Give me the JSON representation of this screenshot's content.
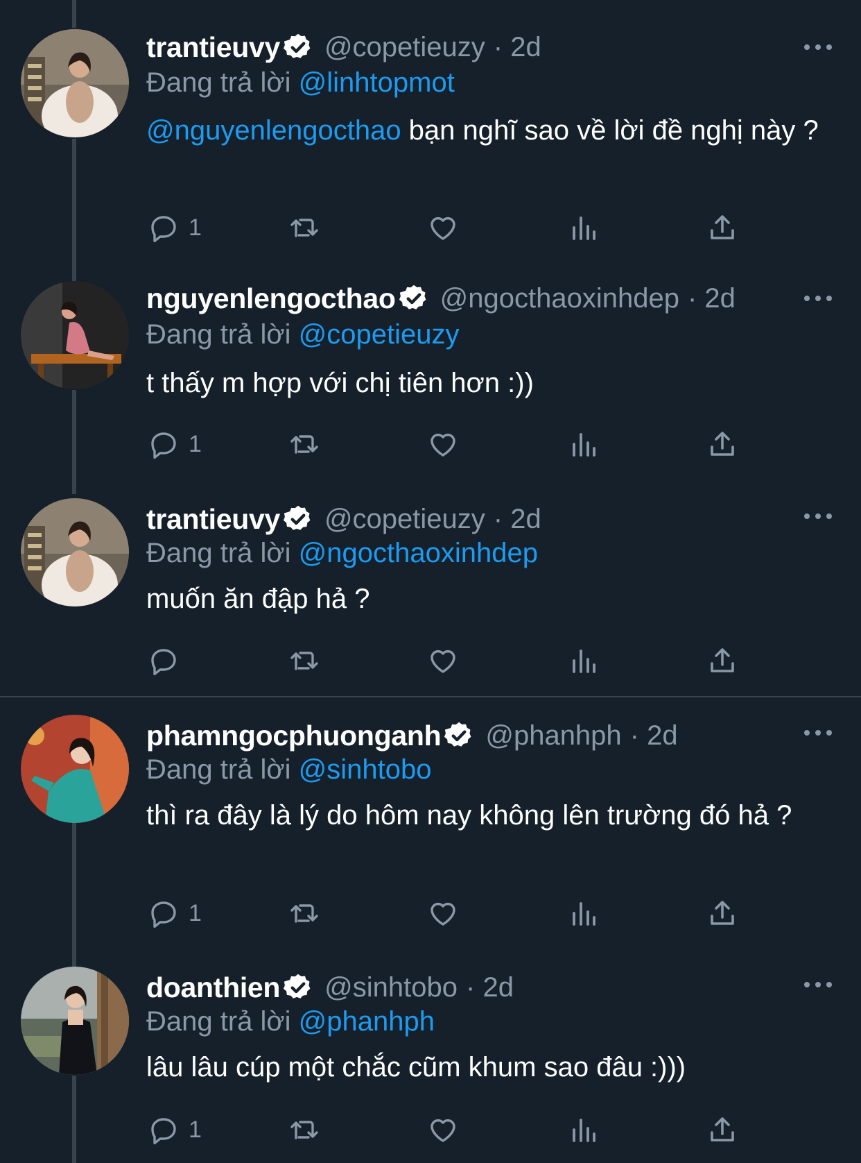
{
  "reply_prefix": "Đang trả lời",
  "colors": {
    "background": "#15202b",
    "text": "#ffffff",
    "muted": "#8b98a5",
    "link": "#1d9bf0",
    "line": "#38444d"
  },
  "tweets": [
    {
      "name": "trantieuvy",
      "handle": "@copetieuzy",
      "time": "· 2d",
      "reply_to": "@linhtopmot",
      "mention": "@nguyenlengocthao",
      "text": " bạn nghĩ sao về lời đề nghị này ?",
      "reply_count": "1",
      "avatar_icon": "woman-white-fur-avatar"
    },
    {
      "name": "nguyenlengocthao",
      "handle": "@ngocthaoxinhdep",
      "time": "· 2d",
      "reply_to": "@copetieuzy",
      "mention": "",
      "text": "t thấy m hợp với chị tiên hơn :))",
      "reply_count": "1",
      "avatar_icon": "woman-pink-dress-avatar"
    },
    {
      "name": "trantieuvy",
      "handle": "@copetieuzy",
      "time": "· 2d",
      "reply_to": "@ngocthaoxinhdep",
      "mention": "",
      "text": "muốn ăn đập hả ?",
      "reply_count": "",
      "avatar_icon": "woman-white-fur-avatar"
    },
    {
      "name": "phamngocphuonganh",
      "handle": "@phanhph",
      "time": "· 2d",
      "reply_to": "@sinhtobo",
      "mention": "",
      "text": "thì ra đây là lý do hôm nay không lên trường đó hả ?",
      "reply_count": "1",
      "avatar_icon": "woman-teal-aodai-avatar"
    },
    {
      "name": "doanthien",
      "handle": "@sinhtobo",
      "time": "· 2d",
      "reply_to": "@phanhph",
      "mention": "",
      "text": "lâu lâu cúp một chắc cũm khum sao đâu :)))",
      "reply_count": "1",
      "avatar_icon": "woman-black-dress-avatar"
    }
  ]
}
